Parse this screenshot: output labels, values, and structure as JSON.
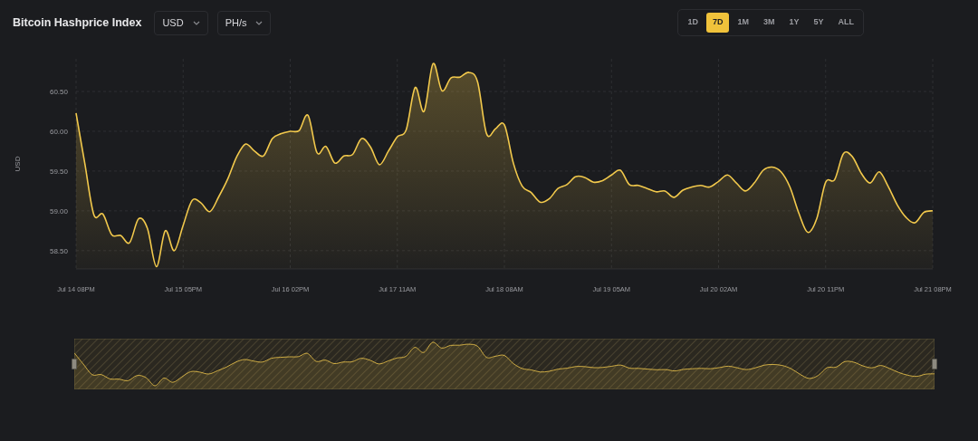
{
  "header": {
    "title": "Bitcoin Hashprice Index",
    "dropdowns": [
      {
        "value": "USD"
      },
      {
        "value": "PH/s"
      }
    ],
    "ranges": [
      {
        "label": "1D",
        "selected": false
      },
      {
        "label": "7D",
        "selected": true
      },
      {
        "label": "1M",
        "selected": false
      },
      {
        "label": "3M",
        "selected": false
      },
      {
        "label": "1Y",
        "selected": false
      },
      {
        "label": "5Y",
        "selected": false
      },
      {
        "label": "ALL",
        "selected": false
      }
    ]
  },
  "chart": {
    "chart_data": {
      "type": "area",
      "ylabel": "USD",
      "categories": [
        "Jul 14 08PM",
        null,
        null,
        null,
        null,
        null,
        null,
        null,
        null,
        null,
        null,
        null,
        "Jul 15 05PM",
        null,
        null,
        null,
        null,
        null,
        null,
        null,
        null,
        null,
        null,
        null,
        "Jul 16 02PM",
        null,
        null,
        null,
        null,
        null,
        null,
        null,
        null,
        null,
        null,
        null,
        "Jul 17 11AM",
        null,
        null,
        null,
        null,
        null,
        null,
        null,
        null,
        null,
        null,
        null,
        "Jul 18 08AM",
        null,
        null,
        null,
        null,
        null,
        null,
        null,
        null,
        null,
        null,
        null,
        "Jul 19 05AM",
        null,
        null,
        null,
        null,
        null,
        null,
        null,
        null,
        null,
        null,
        null,
        "Jul 20 02AM",
        null,
        null,
        null,
        null,
        null,
        null,
        null,
        null,
        null,
        null,
        null,
        "Jul 20 11PM",
        null,
        null,
        null,
        null,
        null,
        null,
        null,
        null,
        null,
        null,
        null,
        "Jul 21 08PM"
      ],
      "series": [
        {
          "color": "#f2c94c",
          "values": [
            60.23,
            59.58,
            58.95,
            58.96,
            58.7,
            58.69,
            58.6,
            58.9,
            58.78,
            58.3,
            58.75,
            58.5,
            58.82,
            59.13,
            59.1,
            58.99,
            59.18,
            59.4,
            59.68,
            59.84,
            59.75,
            59.69,
            59.91,
            59.97,
            60.0,
            60.01,
            60.2,
            59.73,
            59.81,
            59.6,
            59.69,
            59.71,
            59.91,
            59.8,
            59.58,
            59.75,
            59.93,
            60.02,
            60.55,
            60.25,
            60.85,
            60.51,
            60.67,
            60.68,
            60.74,
            60.62,
            59.97,
            60.03,
            60.08,
            59.6,
            59.31,
            59.23,
            59.11,
            59.15,
            59.28,
            59.33,
            59.43,
            59.42,
            59.36,
            59.38,
            59.45,
            59.51,
            59.33,
            59.32,
            59.28,
            59.24,
            59.25,
            59.17,
            59.26,
            59.3,
            59.32,
            59.3,
            59.37,
            59.45,
            59.35,
            59.25,
            59.35,
            59.51,
            59.55,
            59.49,
            59.3,
            58.97,
            58.73,
            58.9,
            59.36,
            59.39,
            59.72,
            59.68,
            59.47,
            59.35,
            59.49,
            59.31,
            59.08,
            58.92,
            58.85,
            58.98,
            59.0
          ]
        }
      ],
      "ylim": [
        58.27,
        60.91
      ],
      "grid": true,
      "yticks": [
        {
          "value": 58.5,
          "label": "58.50"
        },
        {
          "value": 59,
          "label": "59.00"
        },
        {
          "value": 59.5,
          "label": "59.50"
        },
        {
          "value": 60,
          "label": "60.00"
        },
        {
          "value": 60.5,
          "label": "60.50"
        }
      ]
    }
  }
}
